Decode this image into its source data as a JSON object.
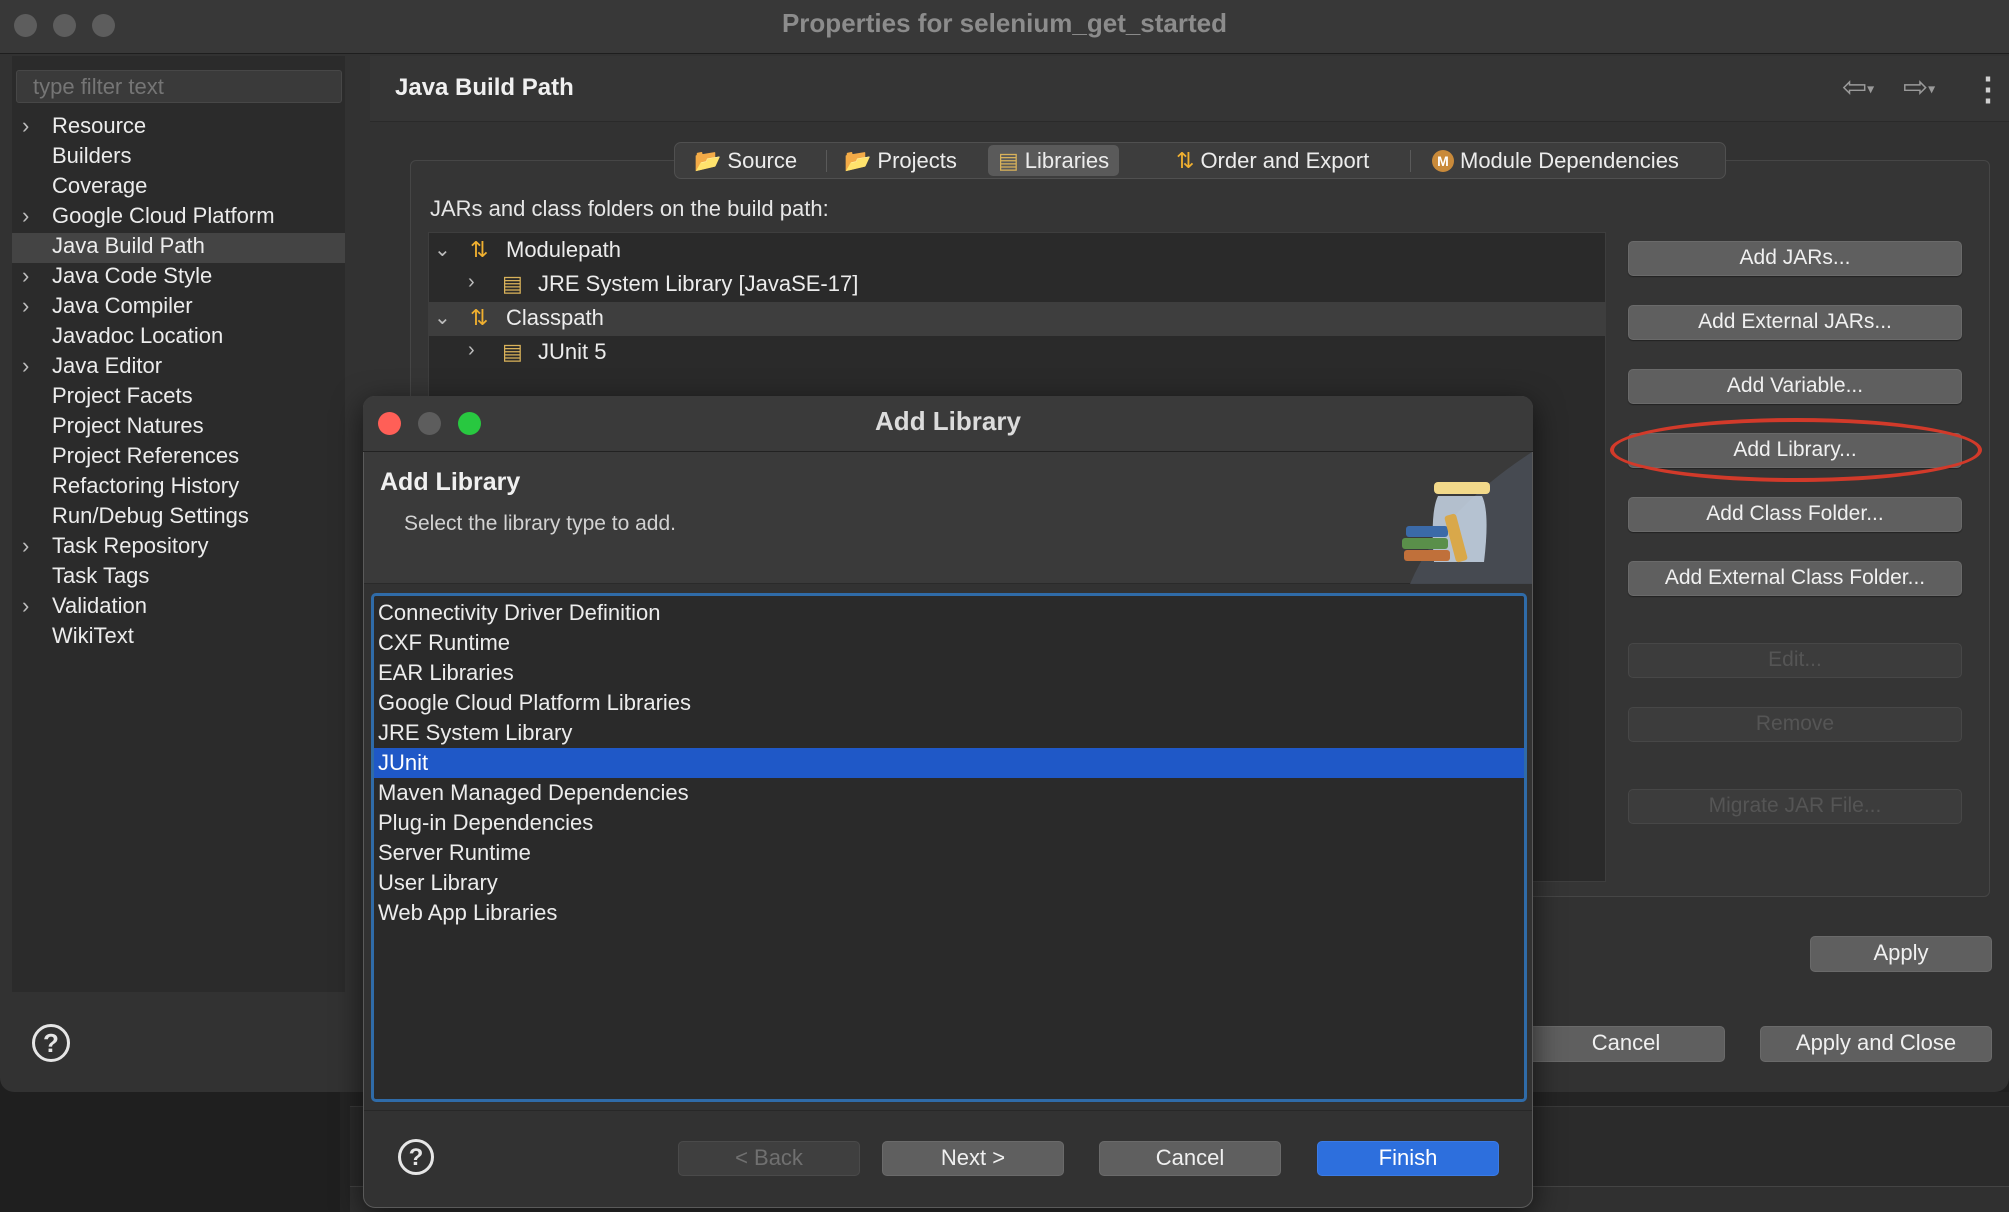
{
  "window": {
    "title": "Properties for selenium_get_started"
  },
  "sidebar": {
    "filter_placeholder": "type filter text",
    "items": [
      {
        "label": "Resource",
        "expandable": true
      },
      {
        "label": "Builders",
        "expandable": false
      },
      {
        "label": "Coverage",
        "expandable": false
      },
      {
        "label": "Google Cloud Platform",
        "expandable": true
      },
      {
        "label": "Java Build Path",
        "expandable": false,
        "selected": true
      },
      {
        "label": "Java Code Style",
        "expandable": true
      },
      {
        "label": "Java Compiler",
        "expandable": true
      },
      {
        "label": "Javadoc Location",
        "expandable": false
      },
      {
        "label": "Java Editor",
        "expandable": true
      },
      {
        "label": "Project Facets",
        "expandable": false
      },
      {
        "label": "Project Natures",
        "expandable": false
      },
      {
        "label": "Project References",
        "expandable": false
      },
      {
        "label": "Refactoring History",
        "expandable": false
      },
      {
        "label": "Run/Debug Settings",
        "expandable": false
      },
      {
        "label": "Task Repository",
        "expandable": true
      },
      {
        "label": "Task Tags",
        "expandable": false
      },
      {
        "label": "Validation",
        "expandable": true
      },
      {
        "label": "WikiText",
        "expandable": false
      }
    ],
    "help": "?"
  },
  "page": {
    "title": "Java Build Path",
    "tabs": [
      {
        "label": "Source",
        "icon": "folder-icon"
      },
      {
        "label": "Projects",
        "icon": "folder-icon"
      },
      {
        "label": "Libraries",
        "icon": "library-icon",
        "selected": true
      },
      {
        "label": "Order and Export",
        "icon": "order-icon"
      },
      {
        "label": "Module Dependencies",
        "icon": "module-icon"
      }
    ],
    "jars_label": "JARs and class folders on the build path:",
    "tree": [
      {
        "label": "Modulepath",
        "expanded": true
      },
      {
        "label": "JRE System Library [JavaSE-17]",
        "expanded": false
      },
      {
        "label": "Classpath",
        "expanded": true
      },
      {
        "label": "JUnit 5",
        "expanded": false
      }
    ],
    "buttons": {
      "add_jars": "Add JARs...",
      "add_external_jars": "Add External JARs...",
      "add_variable": "Add Variable...",
      "add_library": "Add Library...",
      "add_class_folder": "Add Class Folder...",
      "add_external_class_folder": "Add External Class Folder...",
      "edit": "Edit...",
      "remove": "Remove",
      "migrate": "Migrate JAR File..."
    },
    "apply": "Apply",
    "cancel": "Cancel",
    "apply_and_close": "Apply and Close"
  },
  "dialog": {
    "title": "Add Library",
    "heading": "Add Library",
    "description": "Select the library type to add.",
    "items": [
      "Connectivity Driver Definition",
      "CXF Runtime",
      "EAR Libraries",
      "Google Cloud Platform Libraries",
      "JRE System Library",
      "JUnit",
      "Maven Managed Dependencies",
      "Plug-in Dependencies",
      "Server Runtime",
      "User Library",
      "Web App Libraries"
    ],
    "selected_item": "JUnit",
    "buttons": {
      "back": "< Back",
      "next": "Next >",
      "cancel": "Cancel",
      "finish": "Finish"
    },
    "help": "?"
  },
  "colors": {
    "selection_blue": "#1f58c7",
    "primary_button": "#2d6fdd",
    "annotation_red": "#d23a2a",
    "close_red": "#ff5f57",
    "minimize_gray": "#5d5d5d",
    "zoom_green": "#28c840"
  }
}
